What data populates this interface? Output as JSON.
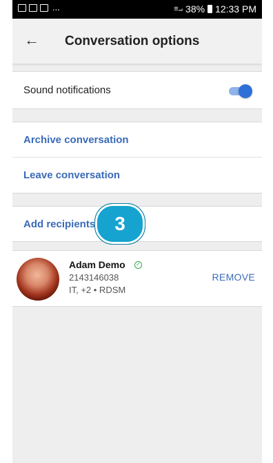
{
  "status_bar": {
    "left_dots": "...",
    "signal_text": "≡⨼",
    "battery": "38%",
    "time": "12:33 PM"
  },
  "app_bar": {
    "back_glyph": "←",
    "title": "Conversation options"
  },
  "settings": {
    "sound_notifications_label": "Sound notifications",
    "sound_notifications_on": true,
    "archive_label": "Archive conversation",
    "leave_label": "Leave conversation",
    "add_recipients_label": "Add recipients"
  },
  "badge": {
    "number": "3"
  },
  "contact": {
    "name": "Adam Demo",
    "verified_icon": "check-circle-icon",
    "phone": "2143146038",
    "meta": "IT, +2 • RDSM",
    "remove_label": "REMOVE"
  },
  "colors": {
    "accent": "#3a6ab8",
    "toggle": "#2f6fd8",
    "badge": "#16a3cf"
  }
}
